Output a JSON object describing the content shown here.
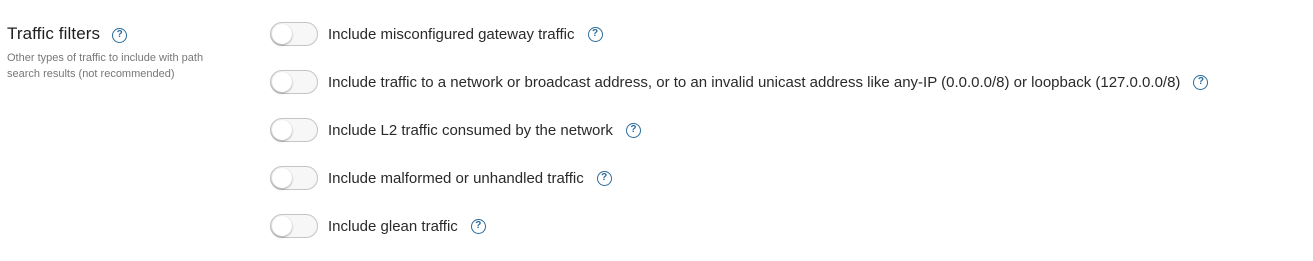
{
  "section": {
    "title": "Traffic filters",
    "help_icon": "help-circle-icon",
    "description": "Other types of traffic to include with path search results (not recommended)"
  },
  "filters": [
    {
      "label": "Include misconfigured gateway traffic",
      "enabled": false
    },
    {
      "label": "Include traffic to a network or broadcast address, or to an invalid unicast address like any-IP (0.0.0.0/8) or loopback (127.0.0.0/8)",
      "enabled": false
    },
    {
      "label": "Include L2 traffic consumed by the network",
      "enabled": false
    },
    {
      "label": "Include malformed or unhandled traffic",
      "enabled": false
    },
    {
      "label": "Include glean traffic",
      "enabled": false
    }
  ],
  "colors": {
    "help_icon": "#2a6a9a",
    "toggle_border": "#c4c4c4",
    "description_text": "#777777"
  }
}
